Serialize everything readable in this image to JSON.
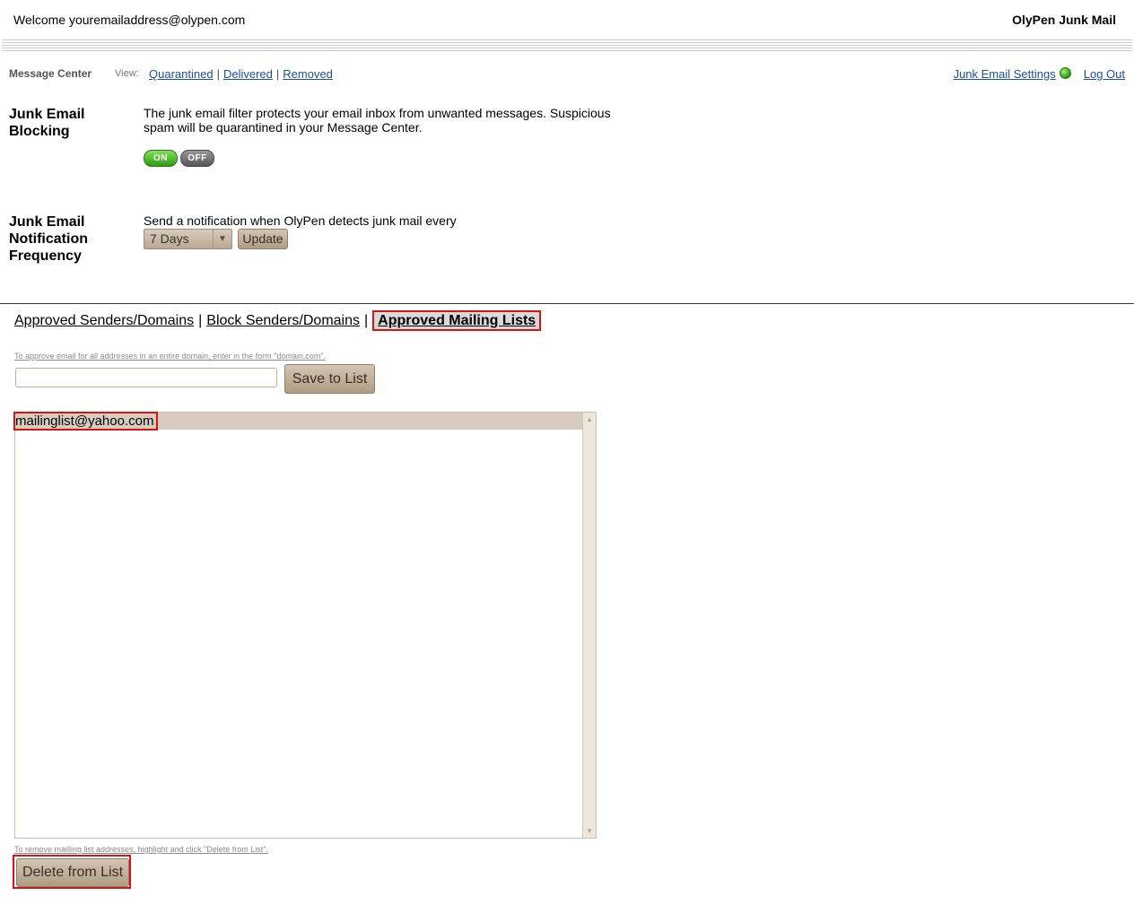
{
  "header": {
    "welcome": "Welcome youremailaddress@olypen.com",
    "brand": "OlyPen Junk Mail"
  },
  "nav": {
    "message_center": "Message Center",
    "view_label": "View:",
    "links": [
      "Quarantined",
      "Delivered",
      "Removed"
    ],
    "settings_link": "Junk Email Settings",
    "logout_link": "Log Out"
  },
  "blocking": {
    "label": "Junk Email Blocking",
    "description": "The junk email filter protects your email inbox from unwanted messages. Suspicious spam will be quarantined in your Message Center.",
    "on_label": "ON",
    "off_label": "OFF"
  },
  "notification": {
    "label": "Junk Email Notification Frequency",
    "description": "Send a notification when OlyPen detects junk mail every",
    "selected": "7 Days",
    "update_label": "Update"
  },
  "tabs": {
    "approved_senders": "Approved Senders/Domains",
    "block_senders": "Block Senders/Domains",
    "approved_lists": "Approved Mailing Lists",
    "separator": "|"
  },
  "list_form": {
    "hint_top": "To approve email for all addresses in an entire domain, enter in the form \"domain.com\".",
    "input_value": "",
    "save_label": "Save to List",
    "items": [
      "mailinglist@yahoo.com"
    ],
    "hint_bottom": "To remove mailling list addresses, highlight and click \"Delete from List\".",
    "delete_label": "Delete from List"
  }
}
